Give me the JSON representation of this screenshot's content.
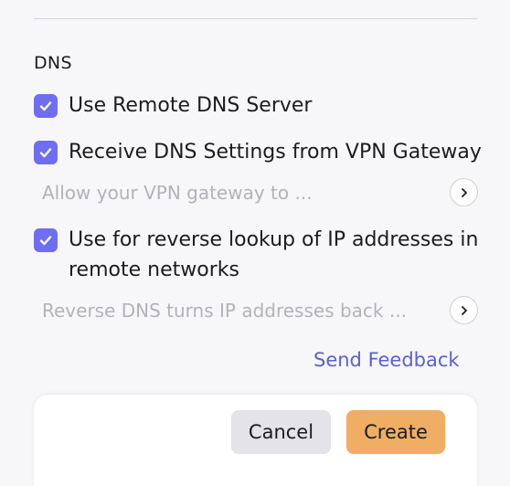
{
  "section": {
    "title": "DNS"
  },
  "options": [
    {
      "label": "Use Remote DNS Server",
      "checked": true
    },
    {
      "label": "Receive DNS Settings from VPN Gateway",
      "checked": true
    },
    {
      "label": "Use for reverse lookup of IP addresses in",
      "label_line2": "remote networks",
      "checked": true
    }
  ],
  "hints": [
    {
      "text": "Allow your VPN gateway to ...",
      "icon": "chevron-right-icon"
    },
    {
      "text": "Reverse DNS turns IP addresses back ...",
      "icon": "chevron-right-icon"
    }
  ],
  "feedback": {
    "label": "Send Feedback"
  },
  "footer": {
    "cancel_label": "Cancel",
    "create_label": "Create"
  },
  "colors": {
    "accent": "#6f6ef0",
    "link": "#5b5fd6",
    "primary_button": "#efae63",
    "secondary_button": "#e3e3e8",
    "hint_text": "#b2b2ba"
  }
}
